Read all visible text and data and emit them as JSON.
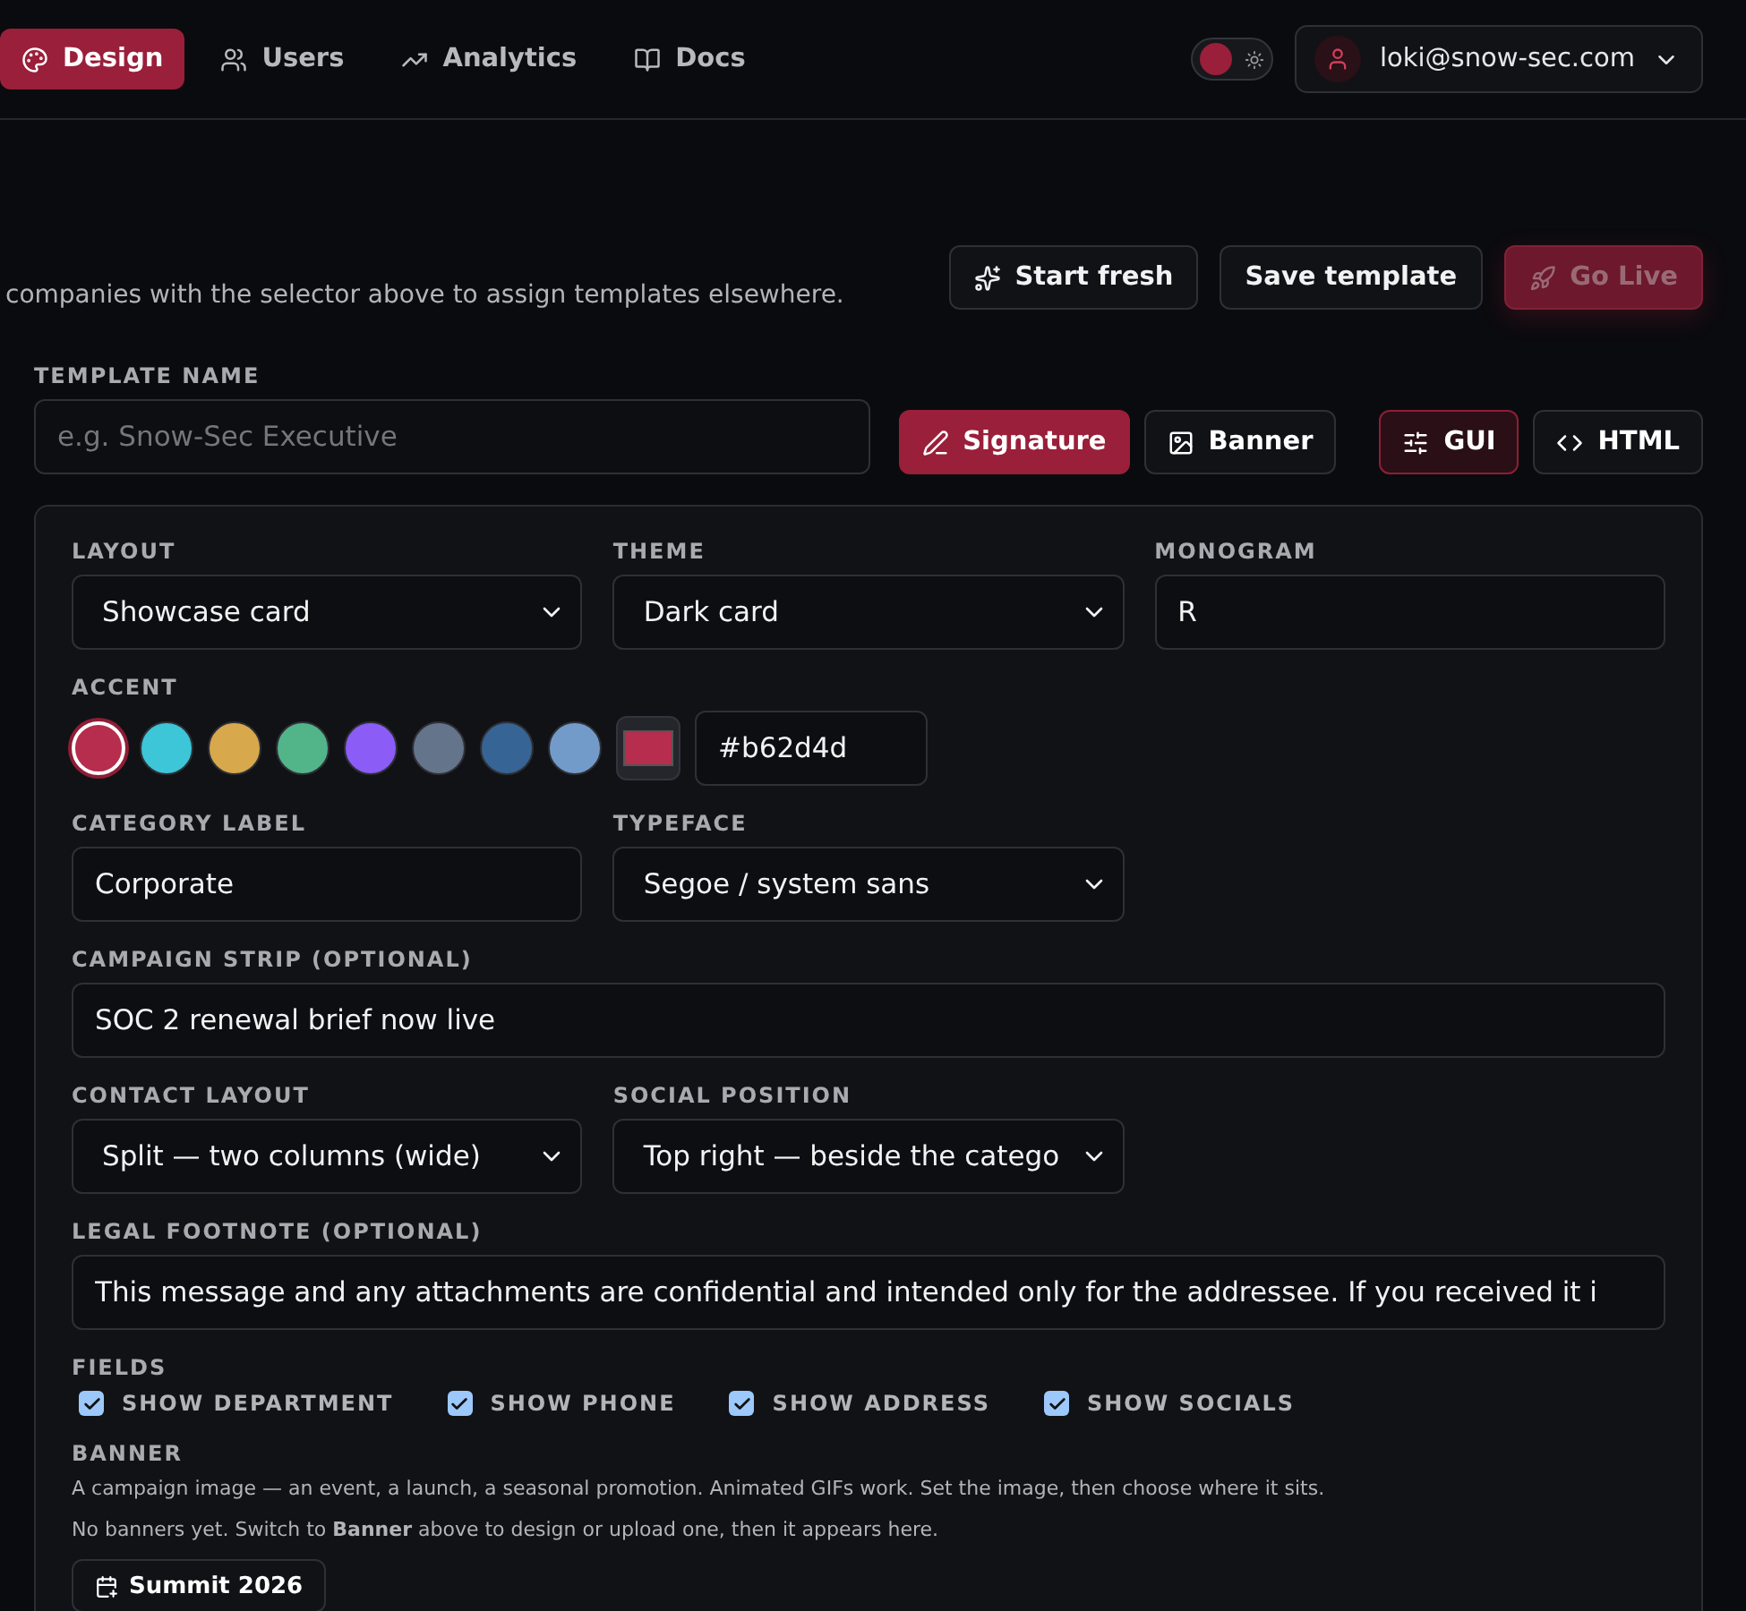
{
  "nav": {
    "items": [
      {
        "label": "Design",
        "selected": true
      },
      {
        "label": "Users",
        "selected": false
      },
      {
        "label": "Analytics",
        "selected": false
      },
      {
        "label": "Docs",
        "selected": false
      }
    ],
    "theme_toggle": {
      "on": false
    },
    "user": {
      "email": "loki@snow-sec.com"
    }
  },
  "toolbar": {
    "description": "companies with the selector above to assign templates elsewhere.",
    "buttons": [
      {
        "label": "Start fresh",
        "kind": "outline"
      },
      {
        "label": "Save template",
        "kind": "outline"
      },
      {
        "label": "Go Live",
        "kind": "primary"
      }
    ]
  },
  "template_name": {
    "label": "TEMPLATE NAME",
    "placeholder": "e.g. Snow-Sec Executive"
  },
  "mode_tabs": [
    {
      "label": "Signature",
      "selected": true
    },
    {
      "label": "Banner",
      "selected": false
    }
  ],
  "view_tabs": [
    {
      "label": "GUI",
      "selected": true
    },
    {
      "label": "HTML",
      "selected": false
    }
  ],
  "editor": {
    "rows": [
      {
        "kind": "grid",
        "fields": [
          {
            "kind": "select",
            "label": "LAYOUT",
            "value": "Showcase card"
          },
          {
            "kind": "select",
            "label": "THEME",
            "value": "Dark card"
          },
          {
            "kind": "input",
            "label": "MONOGRAM",
            "value": "R"
          }
        ]
      },
      {
        "kind": "accent",
        "label": "ACCENT",
        "value": "#b62d4d",
        "swatches": [
          {
            "color": "#b62d4d",
            "selected": true
          },
          {
            "color": "#3cc6d8",
            "selected": false
          },
          {
            "color": "#d8a84c",
            "selected": false
          },
          {
            "color": "#52b58a",
            "selected": false
          },
          {
            "color": "#8b5cf6",
            "selected": false
          },
          {
            "color": "#64748b",
            "selected": false
          },
          {
            "color": "#366494",
            "selected": false
          },
          {
            "color": "#729bc9",
            "selected": false
          }
        ]
      },
      {
        "kind": "grid",
        "fields": [
          {
            "kind": "input",
            "label": "CATEGORY LABEL",
            "value": "Corporate"
          },
          {
            "kind": "select",
            "label": "TYPEFACE",
            "value": "Segoe / system sans"
          }
        ]
      },
      {
        "kind": "full",
        "field": {
          "kind": "input",
          "label": "CAMPAIGN STRIP (OPTIONAL)",
          "value": "SOC 2 renewal brief now live"
        }
      },
      {
        "kind": "grid",
        "fields": [
          {
            "kind": "select",
            "label": "CONTACT LAYOUT",
            "value": "Split — two columns (wide)"
          },
          {
            "kind": "select",
            "label": "SOCIAL POSITION",
            "value": "Top right — beside the catego"
          }
        ]
      },
      {
        "kind": "full",
        "field": {
          "kind": "input",
          "label": "LEGAL FOOTNOTE (OPTIONAL)",
          "value": "This message and any attachments are confidential and intended only for the addressee. If you received it i"
        }
      }
    ],
    "fields": {
      "label": "FIELDS",
      "options": [
        {
          "label": "SHOW DEPARTMENT",
          "checked": true
        },
        {
          "label": "SHOW PHONE",
          "checked": true
        },
        {
          "label": "SHOW ADDRESS",
          "checked": true
        },
        {
          "label": "SHOW SOCIALS",
          "checked": true
        }
      ]
    },
    "banner": {
      "label": "BANNER",
      "hint": "A campaign image — an event, a launch, a seasonal promotion. Animated GIFs work. Set the image, then choose where it sits.",
      "empty_note": "No banners yet. Switch to **Banner** above to design or upload one, then it appears here.",
      "items": [
        {
          "label": "Summit 2026"
        }
      ]
    }
  }
}
